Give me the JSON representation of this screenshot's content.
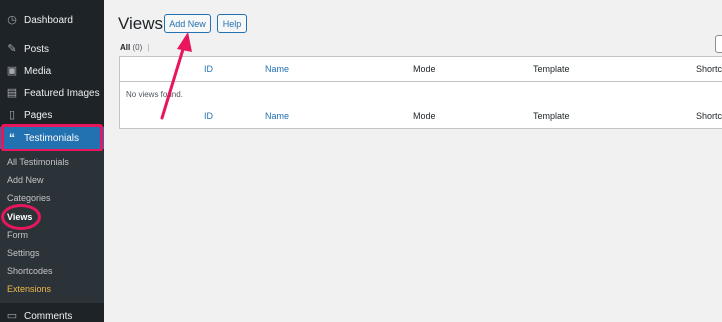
{
  "sidebar": {
    "items": [
      {
        "label": "Dashboard",
        "icon": "dashboard-icon"
      },
      {
        "label": "Posts",
        "icon": "pin-icon"
      },
      {
        "label": "Media",
        "icon": "media-icon"
      },
      {
        "label": "Featured Images",
        "icon": "image-icon"
      },
      {
        "label": "Pages",
        "icon": "pages-icon"
      },
      {
        "label": "Testimonials",
        "icon": "quote-icon"
      },
      {
        "label": "Comments",
        "icon": "comment-icon"
      }
    ],
    "submenu": [
      "All Testimonials",
      "Add New",
      "Categories",
      "Views",
      "Form",
      "Settings",
      "Shortcodes",
      "Extensions"
    ]
  },
  "header": {
    "title": "Views",
    "add_new_label": "Add New",
    "help_label": "Help"
  },
  "filter": {
    "label": "All",
    "count": "(0)",
    "separator": "|"
  },
  "table": {
    "columns": [
      "ID",
      "Name",
      "Mode",
      "Template",
      "Shortcode"
    ],
    "empty_message": "No views found."
  },
  "colors": {
    "accent": "#2271b1",
    "highlight": "#e8175d",
    "sidebar_bg": "#1d2327",
    "extensions": "#f0b849"
  }
}
